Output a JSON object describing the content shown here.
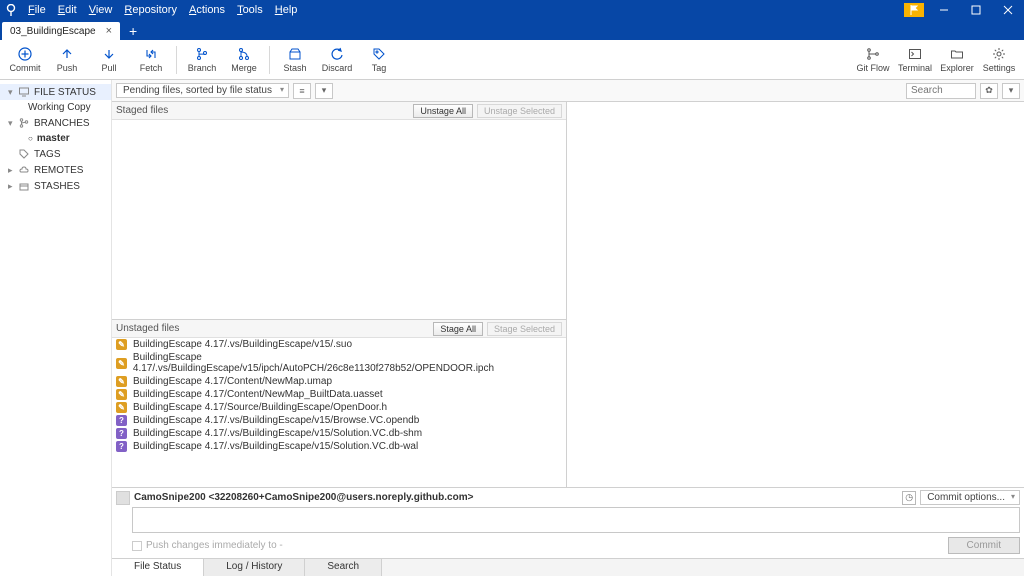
{
  "menu": [
    "File",
    "Edit",
    "View",
    "Repository",
    "Actions",
    "Tools",
    "Help"
  ],
  "tab": {
    "label": "03_BuildingEscape"
  },
  "toolbar": [
    {
      "label": "Commit",
      "icon": "plus-circle"
    },
    {
      "label": "Push",
      "icon": "arrow-up"
    },
    {
      "label": "Pull",
      "icon": "arrow-down"
    },
    {
      "label": "Fetch",
      "icon": "refresh-down"
    },
    {
      "label": "Branch",
      "icon": "branch"
    },
    {
      "label": "Merge",
      "icon": "merge"
    },
    {
      "label": "Stash",
      "icon": "box"
    },
    {
      "label": "Discard",
      "icon": "undo"
    },
    {
      "label": "Tag",
      "icon": "tag"
    }
  ],
  "toolbar_right": [
    {
      "label": "Git Flow",
      "icon": "flow"
    },
    {
      "label": "Terminal",
      "icon": "terminal"
    },
    {
      "label": "Explorer",
      "icon": "folder"
    },
    {
      "label": "Settings",
      "icon": "gear"
    }
  ],
  "sidebar": {
    "file_status": "FILE STATUS",
    "working_copy": "Working Copy",
    "branches": "BRANCHES",
    "master": "master",
    "tags": "TAGS",
    "remotes": "REMOTES",
    "stashes": "STASHES"
  },
  "filter": {
    "pending": "Pending files, sorted by file status",
    "search_placeholder": "Search"
  },
  "staged": {
    "title": "Staged files",
    "unstage_all": "Unstage All",
    "unstage_sel": "Unstage Selected"
  },
  "unstaged": {
    "title": "Unstaged files",
    "stage_all": "Stage All",
    "stage_sel": "Stage Selected",
    "files": [
      {
        "status": "mod",
        "path": "BuildingEscape 4.17/.vs/BuildingEscape/v15/.suo"
      },
      {
        "status": "mod",
        "path": "BuildingEscape 4.17/.vs/BuildingEscape/v15/ipch/AutoPCH/26c8e1130f278b52/OPENDOOR.ipch"
      },
      {
        "status": "mod",
        "path": "BuildingEscape 4.17/Content/NewMap.umap"
      },
      {
        "status": "mod",
        "path": "BuildingEscape 4.17/Content/NewMap_BuiltData.uasset"
      },
      {
        "status": "mod",
        "path": "BuildingEscape 4.17/Source/BuildingEscape/OpenDoor.h"
      },
      {
        "status": "new",
        "path": "BuildingEscape 4.17/.vs/BuildingEscape/v15/Browse.VC.opendb"
      },
      {
        "status": "new",
        "path": "BuildingEscape 4.17/.vs/BuildingEscape/v15/Solution.VC.db-shm"
      },
      {
        "status": "new",
        "path": "BuildingEscape 4.17/.vs/BuildingEscape/v15/Solution.VC.db-wal"
      }
    ]
  },
  "commit": {
    "author": "CamoSnipe200 <32208260+CamoSnipe200@users.noreply.github.com>",
    "options": "Commit options...",
    "push_hint": "Push changes immediately to -",
    "commit_btn": "Commit"
  },
  "bottom_tabs": {
    "file_status": "File Status",
    "log": "Log / History",
    "search": "Search"
  }
}
